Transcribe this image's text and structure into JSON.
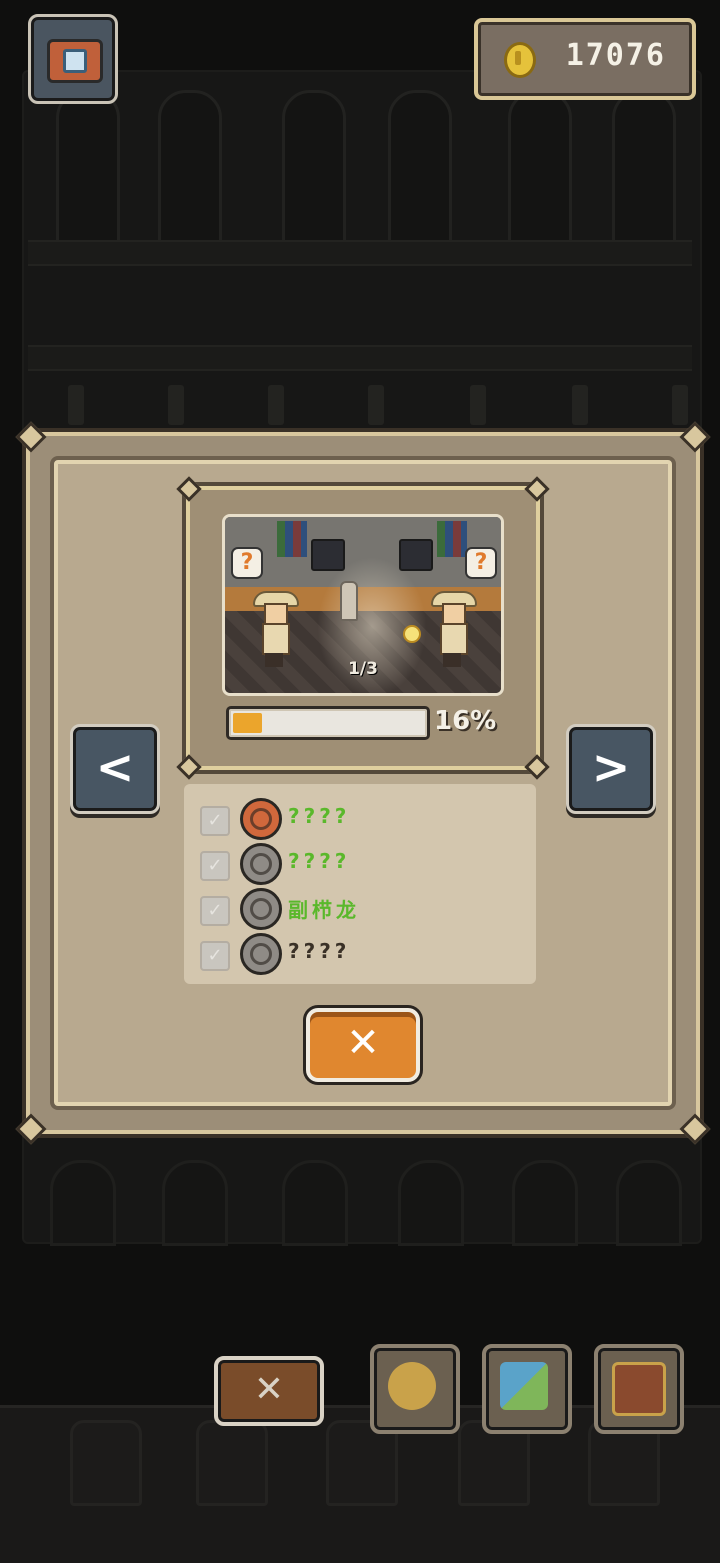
{
  "header": {
    "camera_icon": "camera-icon",
    "coins": "17076",
    "coin_icon": "gold-coin-icon"
  },
  "modal": {
    "preview": {
      "page_indicator": "1/3",
      "progress_percent": 16,
      "progress_text": "16%"
    },
    "prev_label": "<",
    "next_label": ">",
    "fossils": [
      {
        "label": "????",
        "color": "#5ab82b",
        "icon": "fossil-ammonite-icon",
        "icon_color": "#d0683c"
      },
      {
        "label": "????",
        "color": "#5ab82b",
        "icon": "fossil-ammonite-icon",
        "icon_color": "#8f8b86"
      },
      {
        "label": "副栉龙",
        "color": "#5ab82b",
        "icon": "fossil-ammonite-icon",
        "icon_color": "#8f8b86"
      },
      {
        "label": "????",
        "color": "#3a3127",
        "icon": "fossil-ammonite-icon",
        "icon_color": "#8f8b86"
      }
    ],
    "close_label": "✕"
  },
  "toolbar": {
    "close_label": "✕",
    "buttons": [
      {
        "name": "magnifier-hint-icon"
      },
      {
        "name": "treasure-map-icon"
      },
      {
        "name": "fossil-book-icon"
      }
    ]
  },
  "colors": {
    "accent_orange": "#e0872f",
    "nav_blue": "#485663",
    "panel": "#b8a98f",
    "progress": "#eba52c"
  }
}
